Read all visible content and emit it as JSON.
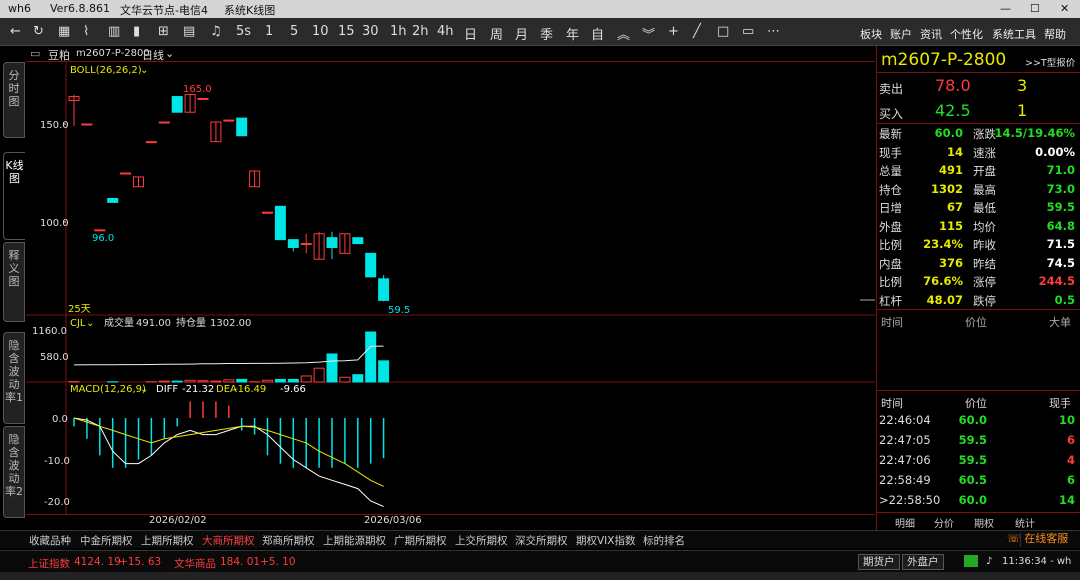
{
  "titlebar": {
    "app": "wh6",
    "version": "Ver6.8.861",
    "server": "文华云节点-电信4",
    "window": "系统K线图",
    "controls": [
      "—",
      "☐",
      "✕"
    ]
  },
  "toolbar": {
    "icons": [
      "back-arrow",
      "refresh",
      "grid",
      "line-chart",
      "bar-chart",
      "candle",
      "calculator",
      "bell",
      "5s"
    ],
    "periods": [
      "1",
      "5",
      "10",
      "15",
      "30",
      "1h",
      "2h",
      "4h",
      "日",
      "周",
      "月",
      "季",
      "年",
      "自"
    ],
    "right_menu": [
      "板块",
      "账户",
      "资讯",
      "个性化",
      "系统工具",
      "帮助"
    ]
  },
  "left_tabs": [
    {
      "label": "分时图",
      "active": false
    },
    {
      "label": "K线图",
      "active": true
    },
    {
      "label": "释义图",
      "active": false
    },
    {
      "label": "隐含波动率1",
      "active": false
    },
    {
      "label": "隐含波动率2",
      "active": false
    }
  ],
  "chart_header": {
    "product": "豆粕",
    "contract": "m2607-P-2800",
    "period": "日线"
  },
  "boll": {
    "label": "BOLL(26,26,2)",
    "high_label": "165.0",
    "low_label": "96.0",
    "last_label": "59.5",
    "days_label": "25天",
    "ticks": [
      "150.0",
      "100.0"
    ]
  },
  "volume": {
    "label": "CJL",
    "vol_label": "成交量",
    "vol_value": "491.00",
    "oi_label": "持仓量",
    "oi_value": "1302.00",
    "ticks": [
      "1160.0",
      "580.0"
    ]
  },
  "macd": {
    "label": "MACD(12,26,9)",
    "diff_label": "DIFF",
    "diff_value": "-21.32",
    "dea_label": "DEA",
    "dea_value": "-16.49",
    "macd_value": "-9.66",
    "ticks": [
      "0.0",
      "-10.0",
      "-20.0"
    ]
  },
  "xaxis": {
    "labels": [
      "2026/02/02",
      "2026/03/06"
    ]
  },
  "chart_data": [
    {
      "type": "candlestick",
      "title": "BOLL(26,26,2)",
      "ylim": [
        50,
        170
      ],
      "candles": [
        {
          "open": 162,
          "close": 164,
          "high": 165,
          "low": 149
        },
        {
          "open": 150,
          "close": 150,
          "high": 150,
          "low": 150
        },
        {
          "open": 96,
          "close": 96,
          "high": 96,
          "low": 96
        },
        {
          "open": 112,
          "close": 110,
          "high": 112,
          "low": 110
        },
        {
          "open": 125,
          "close": 125,
          "high": 125,
          "low": 125
        },
        {
          "open": 118,
          "close": 123,
          "high": 123,
          "low": 118
        },
        {
          "open": 141,
          "close": 141,
          "high": 141,
          "low": 141
        },
        {
          "open": 151,
          "close": 151,
          "high": 151,
          "low": 151
        },
        {
          "open": 164,
          "close": 156,
          "high": 164,
          "low": 156
        },
        {
          "open": 156,
          "close": 165,
          "high": 165,
          "low": 156
        },
        {
          "open": 163,
          "close": 163,
          "high": 163,
          "low": 163
        },
        {
          "open": 141,
          "close": 151,
          "high": 151,
          "low": 141
        },
        {
          "open": 152,
          "close": 152,
          "high": 152,
          "low": 152
        },
        {
          "open": 153,
          "close": 144,
          "high": 153,
          "low": 144
        },
        {
          "open": 118,
          "close": 126,
          "high": 126,
          "low": 118
        },
        {
          "open": 105,
          "close": 105,
          "high": 105,
          "low": 105
        },
        {
          "open": 108,
          "close": 91,
          "high": 108,
          "low": 91
        },
        {
          "open": 91,
          "close": 87,
          "high": 91,
          "low": 85
        },
        {
          "open": 89,
          "close": 89,
          "high": 94,
          "low": 84
        },
        {
          "open": 81,
          "close": 94,
          "high": 95,
          "low": 81
        },
        {
          "open": 92,
          "close": 87,
          "high": 95,
          "low": 81
        },
        {
          "open": 84,
          "close": 94,
          "high": 94,
          "low": 84
        },
        {
          "open": 92,
          "close": 89,
          "high": 92,
          "low": 89
        },
        {
          "open": 84,
          "close": 72,
          "high": 84,
          "low": 72
        },
        {
          "open": 71,
          "close": 60,
          "high": 73,
          "low": 59.5
        }
      ]
    },
    {
      "type": "bar",
      "title": "CJL",
      "ylim": [
        0,
        1300
      ],
      "values": [
        10,
        0,
        0,
        5,
        0,
        0,
        5,
        20,
        20,
        40,
        30,
        20,
        50,
        60,
        5,
        40,
        60,
        60,
        140,
        320,
        650,
        110,
        170,
        1160,
        491
      ],
      "oi": [
        620,
        622,
        624,
        626,
        630,
        632,
        635,
        640,
        645,
        650,
        660,
        665,
        670,
        672,
        675,
        676,
        680,
        690,
        700,
        720,
        760,
        770,
        800,
        1290,
        1302
      ]
    },
    {
      "type": "bar",
      "title": "MACD(12,26,9)",
      "ylim": [
        -22,
        6
      ],
      "values": [
        -2,
        -5,
        -9,
        -12,
        -12,
        -10,
        -9,
        -5,
        -2,
        4,
        4,
        4,
        3,
        -3,
        -4,
        -9,
        -11,
        -12,
        -12,
        -12,
        -12,
        -11,
        -12,
        -11,
        -9.66
      ],
      "diff": [
        0,
        -0.5,
        -2,
        -8,
        -11,
        -11,
        -9,
        -6,
        -4,
        -3,
        -4,
        -4,
        -3,
        -2,
        -2,
        -4,
        -7,
        -10,
        -12,
        -14,
        -15,
        -16,
        -17,
        -20,
        -21.32
      ],
      "dea": [
        0,
        -1,
        -2,
        -3,
        -4,
        -5,
        -6,
        -5,
        -4.5,
        -4,
        -3.5,
        -3,
        -2.5,
        -2,
        -2.2,
        -3,
        -4,
        -5,
        -6,
        -8,
        -9.5,
        -11,
        -13,
        -15,
        -16.49
      ]
    }
  ],
  "quote": {
    "code": "m2607-P-2800",
    "t_link": ">>T型报价",
    "ask_label": "卖出",
    "ask_price": "78.0",
    "ask_vol": "3",
    "bid_label": "买入",
    "bid_price": "42.5",
    "bid_vol": "1",
    "stats": [
      {
        "l1": "最新",
        "v1": "60.0",
        "c1": "green",
        "l2": "涨跌",
        "v2": "-14.5/19.46%",
        "c2": "green"
      },
      {
        "l1": "现手",
        "v1": "14",
        "c1": "yellow",
        "l2": "速涨",
        "v2": "0.00%",
        "c2": "white"
      },
      {
        "l1": "总量",
        "v1": "491",
        "c1": "yellow",
        "l2": "开盘",
        "v2": "71.0",
        "c2": "green"
      },
      {
        "l1": "持仓",
        "v1": "1302",
        "c1": "yellow",
        "l2": "最高",
        "v2": "73.0",
        "c2": "green"
      },
      {
        "l1": "日增",
        "v1": "67",
        "c1": "yellow",
        "l2": "最低",
        "v2": "59.5",
        "c2": "green"
      },
      {
        "l1": "外盘",
        "v1": "115",
        "c1": "yellow",
        "l2": "均价",
        "v2": "64.8",
        "c2": "green"
      },
      {
        "l1": "比例",
        "v1": "23.4%",
        "c1": "yellow",
        "l2": "昨收",
        "v2": "71.5",
        "c2": "white"
      },
      {
        "l1": "内盘",
        "v1": "376",
        "c1": "yellow",
        "l2": "昨结",
        "v2": "74.5",
        "c2": "white"
      },
      {
        "l1": "比例",
        "v1": "76.6%",
        "c1": "yellow",
        "l2": "涨停",
        "v2": "244.5",
        "c2": "red"
      },
      {
        "l1": "杠杆",
        "v1": "48.07",
        "c1": "yellow",
        "l2": "跌停",
        "v2": "0.5",
        "c2": "green"
      }
    ],
    "big_head": {
      "time": "时间",
      "price": "价位",
      "col": "大单"
    },
    "tick_head": {
      "time": "时间",
      "price": "价位",
      "col": "现手"
    },
    "ticks": [
      {
        "time": "22:46:04",
        "price": "60.0",
        "vol": "10",
        "pc": "green",
        "vc": "green"
      },
      {
        "time": "22:47:05",
        "price": "59.5",
        "vol": "6",
        "pc": "green",
        "vc": "red"
      },
      {
        "time": "22:47:06",
        "price": "59.5",
        "vol": "4",
        "pc": "green",
        "vc": "red"
      },
      {
        "time": "22:58:49",
        "price": "60.5",
        "vol": "6",
        "pc": "green",
        "vc": "green"
      },
      {
        "time": ">22:58:50",
        "price": "60.0",
        "vol": "14",
        "pc": "green",
        "vc": "green"
      }
    ],
    "bottom_tabs": [
      "明细",
      "分价",
      "期权",
      "统计"
    ]
  },
  "market_tabs": [
    {
      "label": "收藏品种",
      "active": false
    },
    {
      "label": "中金所期权",
      "active": false
    },
    {
      "label": "上期所期权",
      "active": false
    },
    {
      "label": "大商所期权",
      "active": true
    },
    {
      "label": "郑商所期权",
      "active": false
    },
    {
      "label": "上期能源期权",
      "active": false
    },
    {
      "label": "广期所期权",
      "active": false
    },
    {
      "label": "上交所期权",
      "active": false
    },
    {
      "label": "深交所期权",
      "active": false
    },
    {
      "label": "期权VIX指数",
      "active": false
    },
    {
      "label": "标的排名",
      "active": false
    }
  ],
  "statusbar": {
    "index1_name": "上证指数",
    "index1_val": "4124. 19",
    "index1_chg": "+15. 63",
    "index2_name": "文华商品",
    "index2_val": "184. 01",
    "index2_chg": "+5. 10",
    "btn1": "期货户",
    "btn2": "外盘户",
    "time": "11:36:34 - wh",
    "service": "在线客服"
  },
  "colors": {
    "up": "#ff3b3b",
    "down": "#00e5e5",
    "grid": "#7a1010",
    "yellow": "#e8e800",
    "green": "#22dd22"
  }
}
